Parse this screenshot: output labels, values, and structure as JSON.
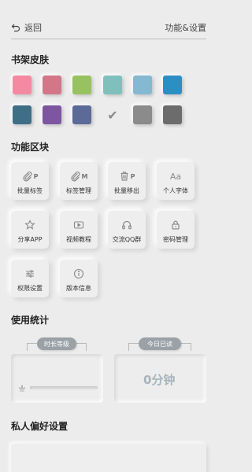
{
  "header": {
    "back_label": "返回",
    "title": "功能&设置"
  },
  "skin_section": {
    "title": "书架皮肤",
    "swatches": [
      {
        "color": "#f48aa2"
      },
      {
        "color": "#d27688"
      },
      {
        "color": "#98c160"
      },
      {
        "color": "#7fc0bd"
      },
      {
        "color": "#85b8d1"
      },
      {
        "color": "#2c8fc4"
      },
      {
        "color": "#3e6f87"
      },
      {
        "color": "#7d55a0"
      },
      {
        "color": "#5b6a96"
      },
      {
        "color": "selected"
      },
      {
        "color": "#8b8b8b"
      },
      {
        "color": "#6c6c6c"
      }
    ],
    "selected_mark": "✔"
  },
  "functions_section": {
    "title": "功能区块",
    "tiles": [
      {
        "label": "批量标签",
        "icon": "tag-icon",
        "sub": "P"
      },
      {
        "label": "标签管理",
        "icon": "paperclip-icon",
        "sub": "M"
      },
      {
        "label": "批量移出",
        "icon": "trash-icon",
        "sub": "P"
      },
      {
        "label": "个人字体",
        "icon": "font-icon",
        "sub": "Aa"
      },
      {
        "label": "分享APP",
        "icon": "star-icon",
        "sub": ""
      },
      {
        "label": "视频教程",
        "icon": "video-icon",
        "sub": ""
      },
      {
        "label": "交流QQ群",
        "icon": "headphones-icon",
        "sub": ""
      },
      {
        "label": "密码管理",
        "icon": "lock-icon",
        "sub": ""
      },
      {
        "label": "权限设置",
        "icon": "sliders-icon",
        "sub": ""
      },
      {
        "label": "版本信息",
        "icon": "info-icon",
        "sub": ""
      }
    ]
  },
  "stats_section": {
    "title": "使用统计",
    "duration_level_label": "时长等级",
    "today_read_label": "今日已读",
    "today_read_value": "0分钟"
  },
  "preferences_section": {
    "title": "私人偏好设置"
  }
}
